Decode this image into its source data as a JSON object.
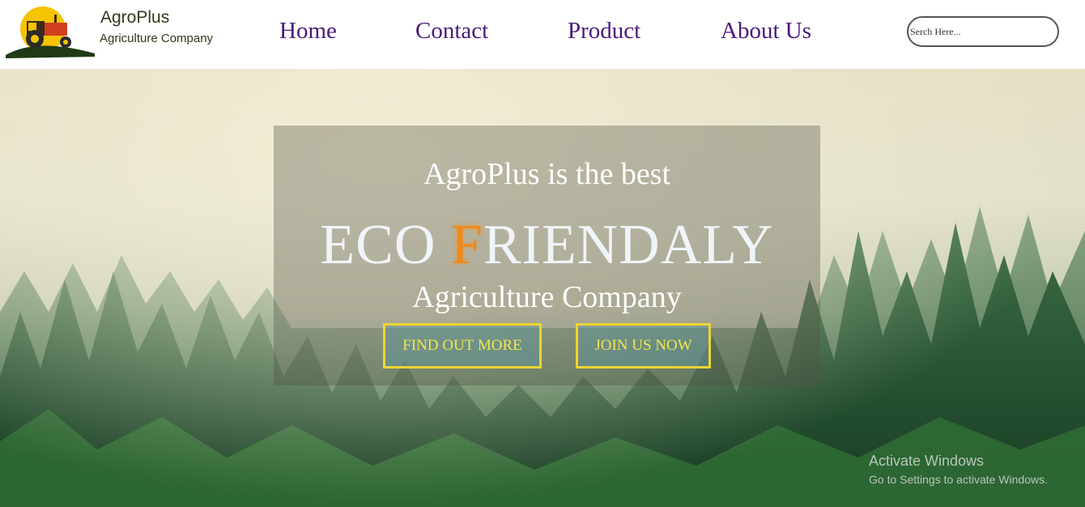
{
  "brand": {
    "name": "AgroPlus",
    "subtitle": "Agriculture Company"
  },
  "nav": {
    "items": [
      {
        "label": "Home"
      },
      {
        "label": "Contact"
      },
      {
        "label": "Product"
      },
      {
        "label": "About Us"
      }
    ]
  },
  "search": {
    "placeholder": "Serch Here..."
  },
  "hero": {
    "tagline": "AgroPlus is the best",
    "title_part1": "ECO ",
    "title_accent": "F",
    "title_part2": "RIENDALY",
    "subtitle": "Agriculture Company",
    "buttons": {
      "find_out_more": "FIND OUT MORE",
      "join_us_now": "JOIN US NOW"
    }
  },
  "watermark": {
    "title": "Activate Windows",
    "subtitle": "Go to Settings to activate Windows."
  },
  "colors": {
    "nav_text": "#4a1a7a",
    "button_border": "#f0d430",
    "button_text": "#f5e64a",
    "accent": "#f0891a",
    "logo_sun": "#f5c400",
    "tractor": "#d04020"
  }
}
